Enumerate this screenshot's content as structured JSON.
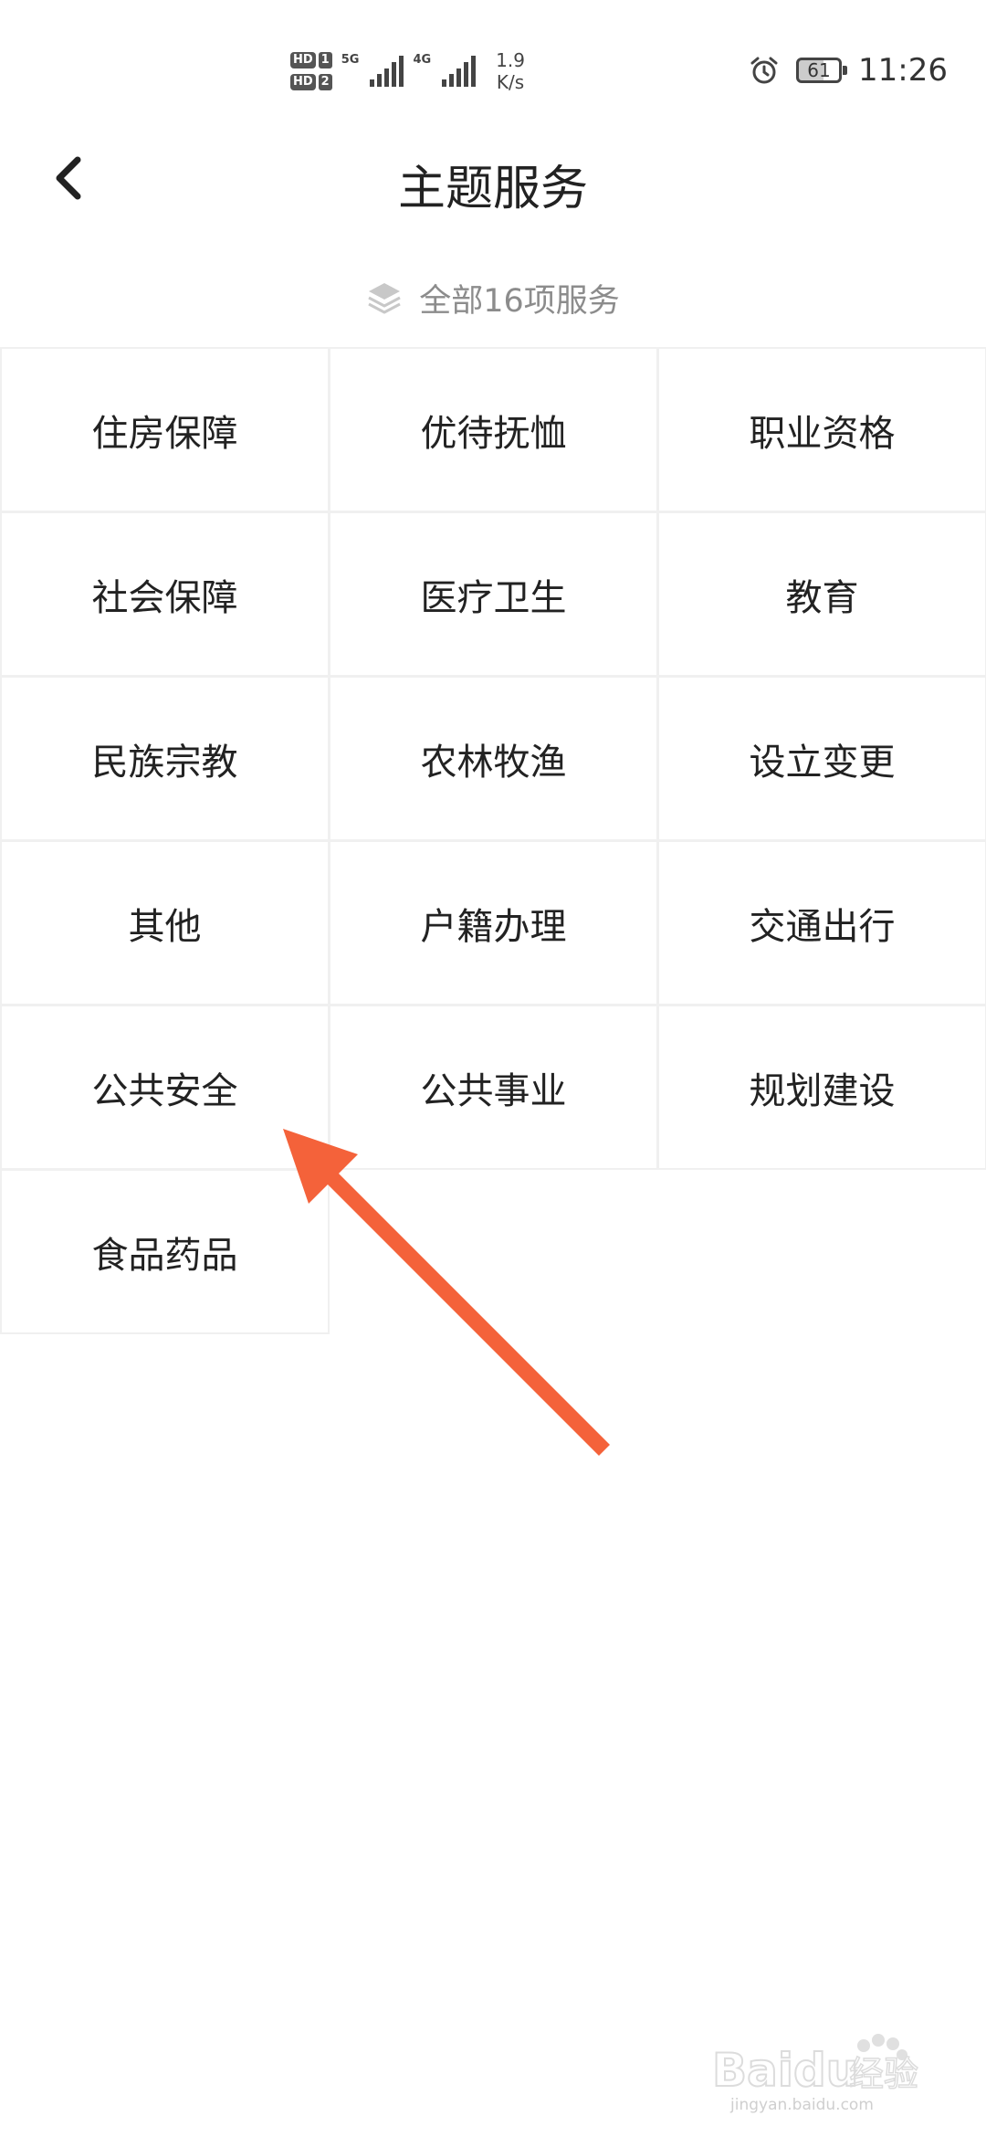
{
  "status_bar": {
    "sim1_badge": "HD",
    "sim1_num": "1",
    "sim2_badge": "HD",
    "sim2_num": "2",
    "net1": "5G",
    "net2": "4G",
    "speed_value": "1.9",
    "speed_unit": "K/s",
    "battery": "61",
    "time": "11:26"
  },
  "header": {
    "title": "主题服务"
  },
  "summary": {
    "count_text": "全部16项服务"
  },
  "services": [
    "住房保障",
    "优待抚恤",
    "职业资格",
    "社会保障",
    "医疗卫生",
    "教育",
    "民族宗教",
    "农林牧渔",
    "设立变更",
    "其他",
    "户籍办理",
    "交通出行",
    "公共安全",
    "公共事业",
    "规划建设",
    "食品药品"
  ],
  "colors": {
    "annotation_arrow": "#f4623a",
    "muted_text": "#8c8c8c",
    "cell_border": "#f0f0f0"
  },
  "watermark": {
    "brand": "Baidu",
    "suffix": "经验",
    "url": "jingyan.baidu.com"
  }
}
